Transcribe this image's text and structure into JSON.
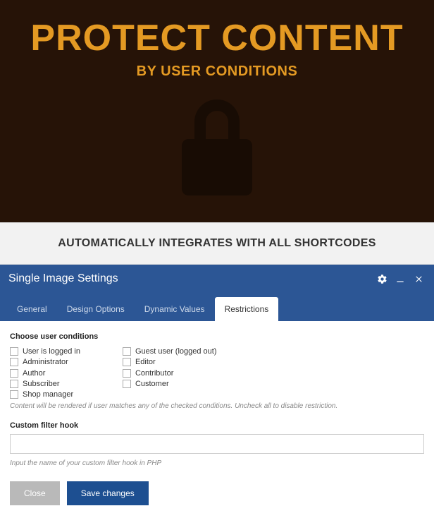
{
  "banner": {
    "title": "PROTECT CONTENT",
    "subtitle": "BY USER CONDITIONS"
  },
  "integrates": "AUTOMATICALLY INTEGRATES WITH ALL SHORTCODES",
  "modal": {
    "title": "Single Image Settings",
    "tabs": {
      "general": "General",
      "design": "Design Options",
      "dynamic": "Dynamic Values",
      "restrictions": "Restrictions"
    },
    "conditions": {
      "label": "Choose user conditions",
      "left": {
        "logged_in": "User is logged in",
        "administrator": "Administrator",
        "author": "Author",
        "subscriber": "Subscriber",
        "shop_manager": "Shop manager"
      },
      "right": {
        "guest": "Guest user (logged out)",
        "editor": "Editor",
        "contributor": "Contributor",
        "customer": "Customer"
      },
      "help": "Content will be rendered if user matches any of the checked conditions. Uncheck all to disable restriction."
    },
    "filter": {
      "label": "Custom filter hook",
      "value": "",
      "placeholder": "",
      "help": "Input the name of your custom filter hook in PHP"
    },
    "actions": {
      "close": "Close",
      "save": "Save changes"
    }
  }
}
